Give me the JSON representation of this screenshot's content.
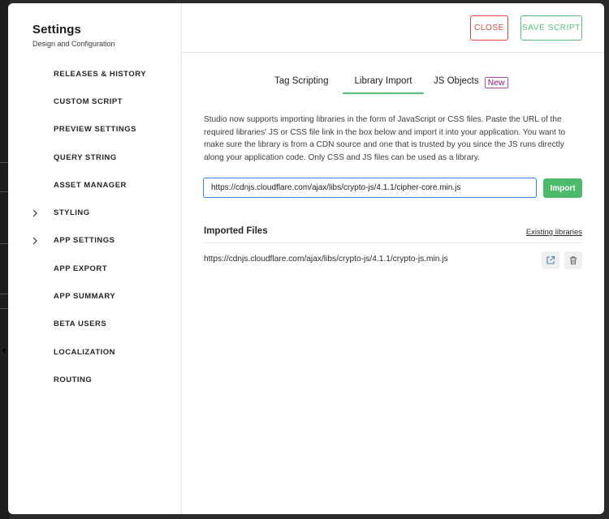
{
  "settings": {
    "title": "Settings",
    "subtitle": "Design and Configuration"
  },
  "sidebar": {
    "items": [
      {
        "label": "RELEASES & HISTORY",
        "expandable": false
      },
      {
        "label": "CUSTOM SCRIPT",
        "expandable": false,
        "active": true
      },
      {
        "label": "PREVIEW SETTINGS",
        "expandable": false
      },
      {
        "label": "QUERY STRING",
        "expandable": false
      },
      {
        "label": "ASSET MANAGER",
        "expandable": false
      },
      {
        "label": "STYLING",
        "expandable": true
      },
      {
        "label": "APP SETTINGS",
        "expandable": true
      },
      {
        "label": "APP EXPORT",
        "expandable": false
      },
      {
        "label": "APP SUMMARY",
        "expandable": false
      },
      {
        "label": "BETA USERS",
        "expandable": false
      },
      {
        "label": "LOCALIZATION",
        "expandable": false
      },
      {
        "label": "ROUTING",
        "expandable": false
      }
    ]
  },
  "toolbar": {
    "close_label": "CLOSE",
    "save_label": "SAVE SCRIPT"
  },
  "tabs": [
    {
      "label": "Tag Scripting",
      "active": false
    },
    {
      "label": "Library Import",
      "active": true
    },
    {
      "label": "JS Objects",
      "active": false,
      "badge": "New"
    }
  ],
  "library": {
    "description": "Studio now supports importing libraries in the form of JavaScript or CSS files. Paste the URL of the required libraries' JS or CSS file link in the box below and import it into your application. You want to make sure the library is from a CDN source and one that is trusted by you since the JS runs directly along your application code. Only CSS and JS files can be used as a library.",
    "url_value": "https://cdnjs.cloudflare.com/ajax/libs/crypto-js/4.1.1/cipher-core.min.js",
    "import_label": "Import",
    "imported_title": "Imported Files",
    "existing_link": "Existing libraries",
    "files": [
      {
        "url": "https://cdnjs.cloudflare.com/ajax/libs/crypto-js/4.1.1/crypto-js.min.js"
      }
    ]
  },
  "colors": {
    "accent_green": "#58c07d",
    "danger_red": "#e0453d",
    "badge_purple": "#8b1d7a",
    "input_focus": "#3a7fd8"
  },
  "icons": {
    "expand": "chevron-right-icon",
    "open": "external-link-icon",
    "delete": "trash-icon"
  }
}
